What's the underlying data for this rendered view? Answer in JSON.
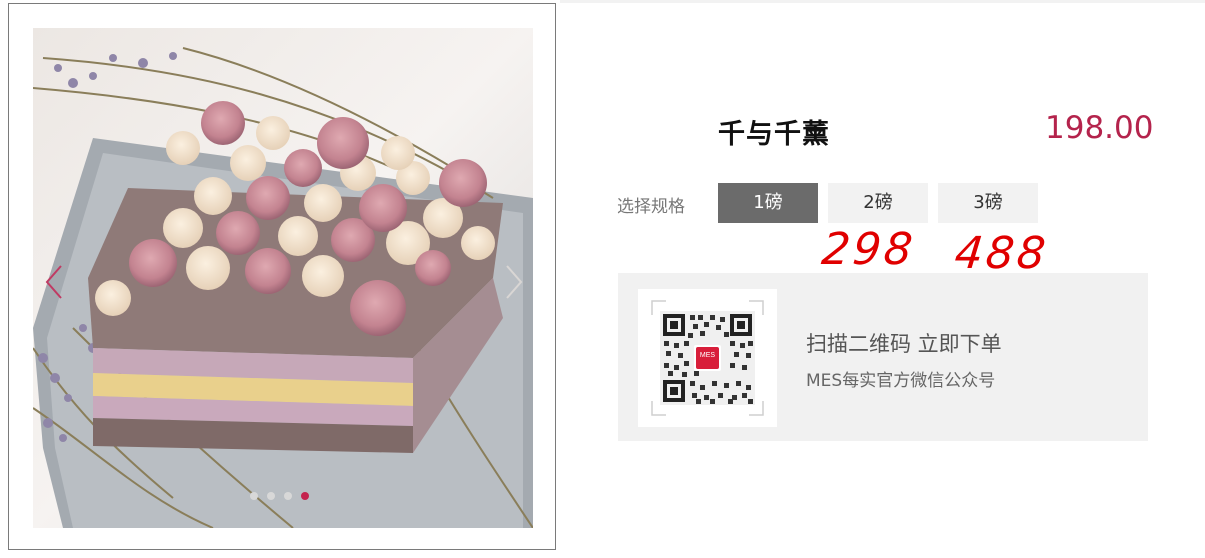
{
  "product": {
    "title": "千与千薰",
    "price": "198.00"
  },
  "spec": {
    "label": "选择规格",
    "options": [
      "1磅",
      "2磅",
      "3磅"
    ],
    "selected_index": 0
  },
  "handwritten_notes": [
    "298",
    "488"
  ],
  "gallery": {
    "slide_count": 4,
    "active_slide": 4,
    "prev_icon": "chevron-left-icon",
    "next_icon": "chevron-right-icon"
  },
  "qr": {
    "title": "扫描二维码 立即下单",
    "subtitle": "MES每实官方微信公众号",
    "logo_text": "MES"
  },
  "colors": {
    "price": "#b4234c",
    "selected_option_bg": "#6b6b6b",
    "active_dot": "#c4234e",
    "handwriting": "#e00000",
    "panel_bg": "#f1f1f1"
  }
}
